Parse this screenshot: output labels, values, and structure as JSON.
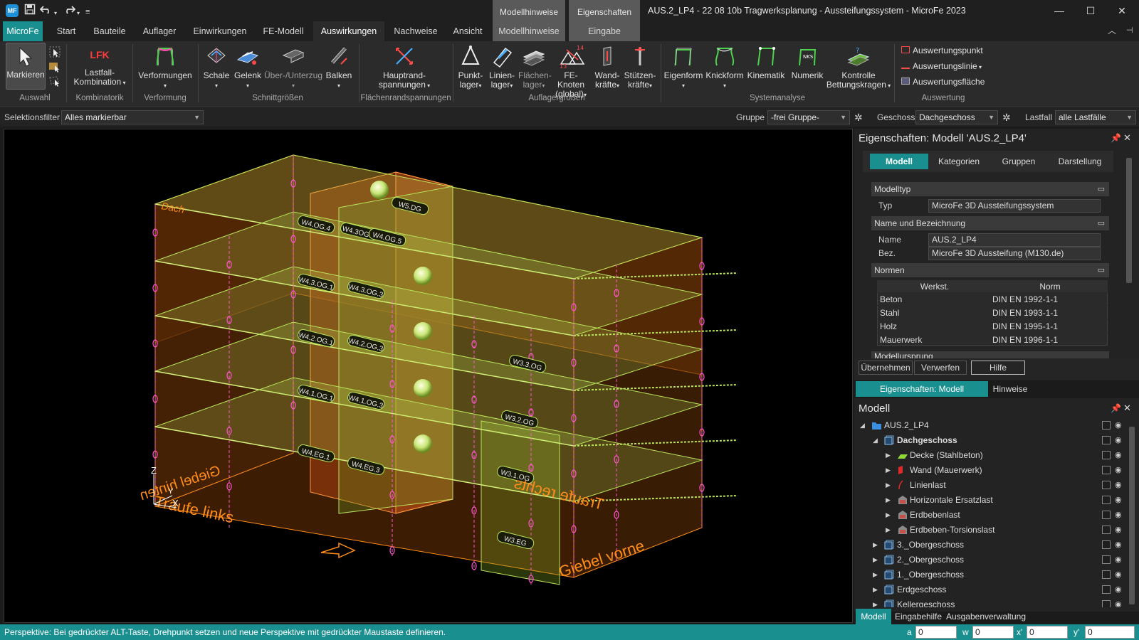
{
  "app": {
    "logo": "MF",
    "title": "AUS.2_LP4 - 22 08 10b Tragwerksplanung - Aussteifungssystem - MicroFe 2023"
  },
  "quick_access": {
    "save_icon": "save-icon",
    "undo_icon": "undo-icon",
    "redo_icon": "redo-icon"
  },
  "window": {
    "minimize": "—",
    "maximize": "☐",
    "close": "✕"
  },
  "context_tabs": {
    "hinweise": {
      "header": "Modellhinweise",
      "tab": "Modellhinweise"
    },
    "eigenschaften": {
      "header": "Eigenschaften",
      "tab": "Eingabe"
    }
  },
  "tabs": [
    {
      "label": "MicroFe"
    },
    {
      "label": "Start"
    },
    {
      "label": "Bauteile"
    },
    {
      "label": "Auflager"
    },
    {
      "label": "Einwirkungen"
    },
    {
      "label": "FE-Modell"
    },
    {
      "label": "Auswirkungen"
    },
    {
      "label": "Nachweise"
    },
    {
      "label": "Ansicht"
    }
  ],
  "ribbon": {
    "markieren": "Markieren",
    "lfk_icon_text": "LFK",
    "lastfall": "Lastfall-",
    "kombination": "Kombination",
    "verformungen": "Verformungen",
    "schale": "Schale",
    "gelenk": "Gelenk",
    "ueber": "Über-/Unterzug",
    "balken": "Balken",
    "hauptrand1": "Hauptrand-",
    "hauptrand2": "spannungen",
    "punkt1": "Punkt-",
    "punkt2": "lager",
    "linien1": "Linien-",
    "linien2": "lager",
    "flaechen1": "Flächen-",
    "flaechen2": "lager",
    "fe1": "FE-Knoten",
    "fe2": "(global)",
    "wand1": "Wand-",
    "wand2": "kräfte",
    "stuetz1": "Stützen-",
    "stuetz2": "kräfte",
    "eigenform": "Eigenform",
    "knickform": "Knickform",
    "kinematik": "Kinematik",
    "numerik": "Numerik",
    "kontrolle1": "Kontrolle",
    "kontrolle2": "Bettungskragen",
    "auswertungspunkt": "Auswertungspunkt",
    "auswertungslinie": "Auswertungslinie",
    "auswertungsflaeche": "Auswertungsfläche",
    "groups": {
      "auswahl": "Auswahl",
      "kombinatorik": "Kombinatorik",
      "verformung": "Verformung",
      "schnitt": "Schnittgrößen",
      "flaechen": "Flächenrandspannungen",
      "auflager": "Auflagergrößen",
      "system": "Systemanalyse",
      "auswertung": "Auswertung"
    }
  },
  "filterbar": {
    "selektion_label": "Selektionsfilter",
    "selektion_value": "Alles markierbar",
    "gruppe_label": "Gruppe",
    "gruppe_value": "-frei Gruppe-",
    "geschoss_label": "Geschoss",
    "geschoss_value": "Dachgeschoss",
    "lastfall_label": "Lastfall",
    "lastfall_value": "alle Lastfälle"
  },
  "viewport": {
    "face_labels": {
      "dach": "Dach",
      "traufe_links": "Traufe links",
      "traufe_rechts": "Traufe rechts",
      "giebel_hinten": "Giebel hinten",
      "giebel_vorne": "Giebel vorne"
    },
    "wall_labels": [
      "W5.DG",
      "W4.OG.4",
      "W4.3OG.2",
      "W4.OG.5",
      "W4.3.OG.1",
      "W4.3.OG.3",
      "W4.2.OG.1",
      "W4.2.OG.3",
      "W3.3.OG",
      "W4.1.OG.1",
      "W4.1.OG.3",
      "W3.2.OG",
      "W4.EG.1",
      "W4.EG.3",
      "W3.1.OG",
      "W3.EG"
    ],
    "axes": {
      "z": "Z",
      "y": "Y",
      "x": "X"
    }
  },
  "properties": {
    "title": "Eigenschaften: Modell 'AUS.2_LP4'",
    "tabs": [
      "Modell",
      "Kategorien",
      "Gruppen",
      "Darstellung"
    ],
    "sections": {
      "modelltyp": "Modelltyp",
      "name": "Name und Bezeichnung",
      "normen": "Normen",
      "modellursprung": "Modellursprung"
    },
    "typ_label": "Typ",
    "typ_value": "MicroFe 3D Aussteifungssystem",
    "name_label": "Name",
    "name_value": "AUS.2_LP4",
    "bez_label": "Bez.",
    "bez_value": "MicroFe 3D Aussteifung (M130.de)",
    "normen_headers": [
      "Werkst.",
      "Norm"
    ],
    "normen_rows": [
      [
        "Beton",
        "DIN EN 1992-1-1"
      ],
      [
        "Stahl",
        "DIN EN 1993-1-1"
      ],
      [
        "Holz",
        "DIN EN 1995-1-1"
      ],
      [
        "Mauerwerk",
        "DIN EN 1996-1-1"
      ]
    ],
    "buttons": [
      "Übernehmen",
      "Verwerfen",
      "Hilfe"
    ],
    "bottom_tabs": [
      "Eigenschaften: Modell 'AUS.2_LP4'",
      "Hinweise"
    ]
  },
  "model": {
    "title": "Modell",
    "tree": [
      {
        "label": "AUS.2_LP4",
        "level": 0,
        "icon": "folder-icon",
        "expanded": true
      },
      {
        "label": "Dachgeschoss",
        "level": 1,
        "icon": "storey-icon",
        "expanded": true,
        "bold": true
      },
      {
        "label": "Decke (Stahlbeton)",
        "level": 2,
        "icon": "slab-icon"
      },
      {
        "label": "Wand (Mauerwerk)",
        "level": 2,
        "icon": "wall-icon"
      },
      {
        "label": "Linienlast",
        "level": 2,
        "icon": "line-load-icon"
      },
      {
        "label": "Horizontale Ersatzlast",
        "level": 2,
        "icon": "load-case-icon"
      },
      {
        "label": "Erdbebenlast",
        "level": 2,
        "icon": "load-case-icon"
      },
      {
        "label": "Erdbeben-Torsionslast",
        "level": 2,
        "icon": "load-case-icon"
      },
      {
        "label": "3._Obergeschoss",
        "level": 1,
        "icon": "storey-icon"
      },
      {
        "label": "2._Obergeschoss",
        "level": 1,
        "icon": "storey-icon"
      },
      {
        "label": "1._Obergeschoss",
        "level": 1,
        "icon": "storey-icon"
      },
      {
        "label": "Erdgeschoss",
        "level": 1,
        "icon": "storey-icon"
      },
      {
        "label": "Kellergeschoss",
        "level": 1,
        "icon": "storey-icon"
      }
    ],
    "bottom_tabs": [
      "Modell",
      "Eingabehilfe",
      "Ausgabenverwaltung"
    ]
  },
  "status": {
    "message": "Perspektive: Bei gedrückter ALT-Taste, Drehpunkt setzen und neue Perspektive mit gedrückter Maustaste definieren.",
    "a_label": "a",
    "a_value": "0",
    "w_label": "w",
    "w_value": "0",
    "x_label": "x'",
    "x_value": "0",
    "y_label": "y'",
    "y_value": "0"
  },
  "colors": {
    "accent": "#1a8f8f",
    "wall_orange": "#ff8c1a",
    "slab_green": "#b9e35a"
  }
}
